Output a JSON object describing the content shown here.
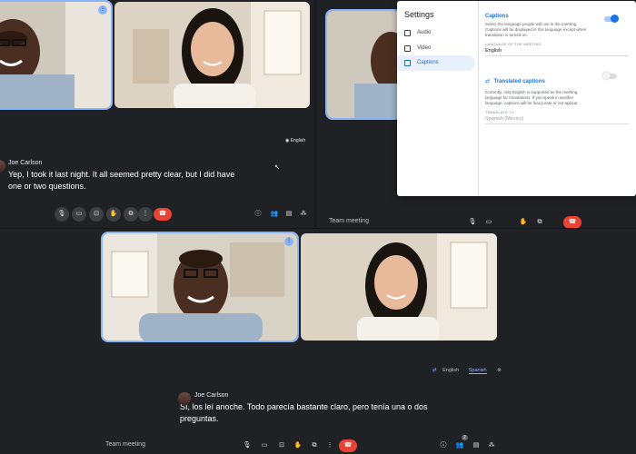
{
  "top_left": {
    "language_chip": "English",
    "caption": {
      "speaker": "Joe Carlson",
      "text": "Yep, I took it last night. It all seemed pretty clear, but I did have one or two questions."
    }
  },
  "top_right": {
    "meeting_name": "Team meeting",
    "settings": {
      "title": "Settings",
      "sidebar": [
        {
          "label": "Audio",
          "icon": "speaker-icon"
        },
        {
          "label": "Video",
          "icon": "camera-icon"
        },
        {
          "label": "Captions",
          "icon": "captions-icon"
        }
      ],
      "captions": {
        "title": "Captions",
        "description": "Select the language people will use in the meeting. Captions will be displayed in this language except when translation is turned on.",
        "language_label": "LANGUAGE OF THE MEETING",
        "language_value": "English",
        "enabled": true
      },
      "translated": {
        "title": "Translated captions",
        "description": "Currently, only English is supported as the meeting language for translations. If you speak in another language, captions will be inaccurate or not appear.",
        "translate_label": "TRANSLATE TO",
        "translate_value": "Spanish (Mexico)",
        "enabled": false
      }
    }
  },
  "bottom": {
    "meeting_name": "Team meeting",
    "lang_source": "English",
    "lang_target": "Spanish",
    "caption": {
      "speaker": "Joe Carlson",
      "text": "Sí, los leí anoche. Todo parecía bastante claro, pero tenía una o dos preguntas."
    },
    "participant_count": "2"
  },
  "colors": {
    "accent": "#8ab4f8",
    "end_call": "#ea4335",
    "background": "#202124",
    "settings_blue": "#1a73e8"
  }
}
